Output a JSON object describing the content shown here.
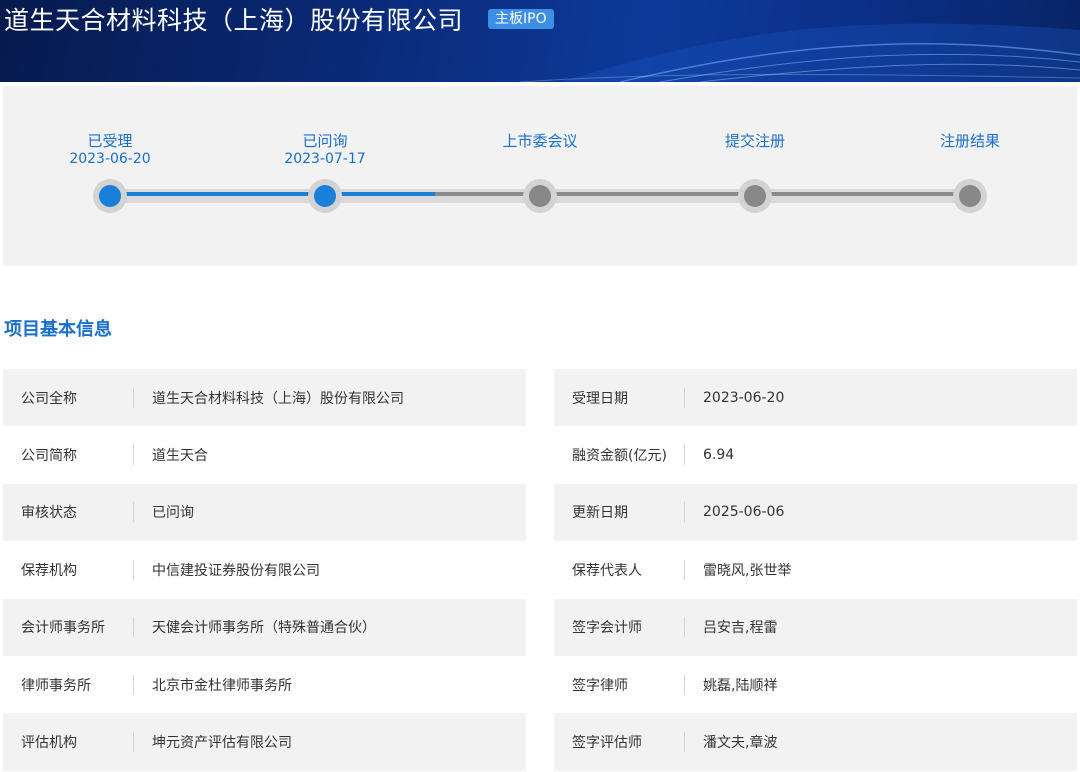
{
  "header": {
    "company_title": "道生天合材料科技（上海）股份有限公司",
    "board_tag": "主板IPO"
  },
  "progress": {
    "steps": [
      {
        "label": "已受理",
        "date": "2023-06-20",
        "status": "done"
      },
      {
        "label": "已问询",
        "date": "2023-07-17",
        "status": "current"
      },
      {
        "label": "上市委会议",
        "date": "",
        "status": "pending"
      },
      {
        "label": "提交注册",
        "date": "",
        "status": "pending"
      },
      {
        "label": "注册结果",
        "date": "",
        "status": "pending"
      }
    ],
    "colors": {
      "active": "#1a7fd9",
      "pending": "#888888",
      "track": "#d9d9d9"
    }
  },
  "section": {
    "title": "项目基本信息"
  },
  "info": {
    "left": [
      {
        "label": "公司全称",
        "value": "道生天合材料科技（上海）股份有限公司"
      },
      {
        "label": "公司简称",
        "value": "道生天合"
      },
      {
        "label": "审核状态",
        "value": "已问询"
      },
      {
        "label": "保荐机构",
        "value": "中信建投证券股份有限公司"
      },
      {
        "label": "会计师事务所",
        "value": "天健会计师事务所（特殊普通合伙）"
      },
      {
        "label": "律师事务所",
        "value": "北京市金杜律师事务所"
      },
      {
        "label": "评估机构",
        "value": "坤元资产评估有限公司"
      }
    ],
    "right": [
      {
        "label": "受理日期",
        "value": "2023-06-20"
      },
      {
        "label": "融资金额(亿元)",
        "value": "6.94"
      },
      {
        "label": "更新日期",
        "value": "2025-06-06"
      },
      {
        "label": "保荐代表人",
        "value": "雷晓风,张世举"
      },
      {
        "label": "签字会计师",
        "value": "吕安吉,程雷"
      },
      {
        "label": "签字律师",
        "value": "姚磊,陆顺祥"
      },
      {
        "label": "签字评估师",
        "value": "潘文夫,章波"
      }
    ]
  }
}
